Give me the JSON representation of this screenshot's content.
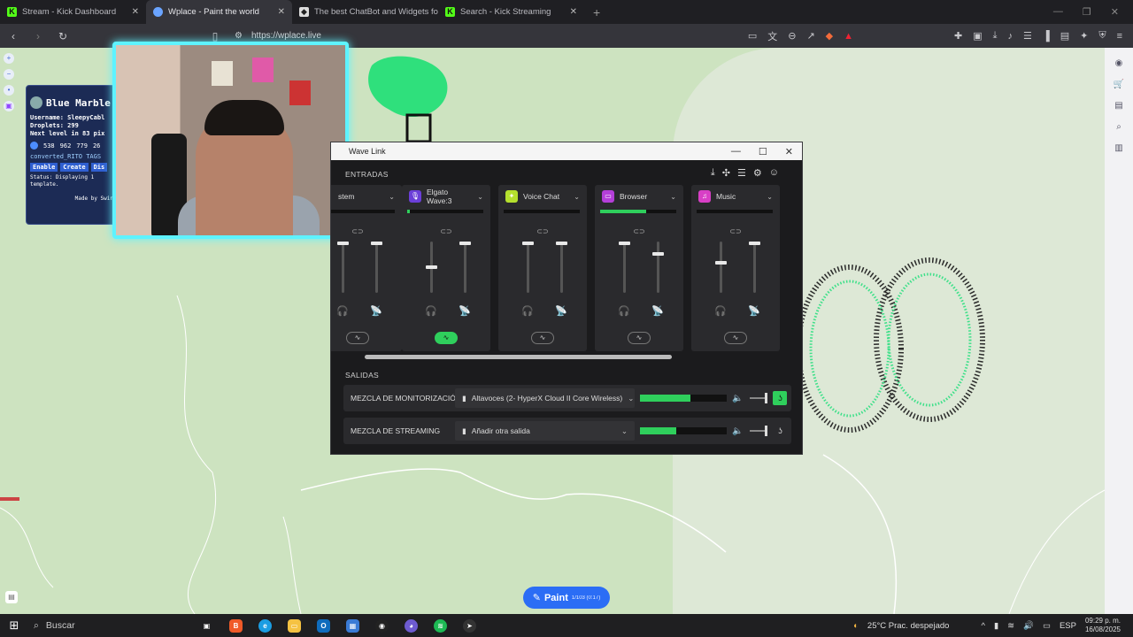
{
  "browser": {
    "tabs": [
      {
        "title": "Stream - Kick Dashboard",
        "icon": "K",
        "kind": "kick",
        "active": false
      },
      {
        "title": "Wplace - Paint the world",
        "icon": "",
        "kind": "wplace",
        "active": true
      },
      {
        "title": "The best ChatBot and Widgets fo",
        "icon": "◆",
        "kind": "chat",
        "active": false
      },
      {
        "title": "Search - Kick Streaming",
        "icon": "K",
        "kind": "kick",
        "active": false
      }
    ],
    "url": "https://wplace.live"
  },
  "overlay": {
    "title": "Blue Marble",
    "username": "Username: SleepyCabl",
    "droplets": "Droplets: 299",
    "next_level": "Next level in 83 pix",
    "coords": [
      "538",
      "962",
      "779",
      "26"
    ],
    "template": "converted_RITO TAGS",
    "btn_enable": "Enable",
    "btn_create": "Create",
    "btn_disable": "Dis",
    "status": "Status: Displaying 1 template.",
    "made_by": "Made by Swin"
  },
  "wavelink": {
    "window_title": "Wave Link",
    "inputs_label": "ENTRADAS",
    "outputs_label": "SALIDAS",
    "channels": [
      {
        "name": "stem",
        "icon_color": "#2a2a2d",
        "icon_glyph": "",
        "meter": 0.0,
        "fader1": 0.0,
        "fader2": 0.0,
        "fx_on": false
      },
      {
        "name": "Elgato Wave:3",
        "icon_color": "#6b3fd8",
        "icon_glyph": "🎙",
        "meter": 0.04,
        "fader1": 0.5,
        "fader2": 0.0,
        "fx_on": true
      },
      {
        "name": "Voice Chat",
        "icon_color": "#b5e02e",
        "icon_glyph": "✦",
        "meter": 0.0,
        "fader1": 0.0,
        "fader2": 0.0,
        "fx_on": false
      },
      {
        "name": "Browser",
        "icon_color": "#b43fd8",
        "icon_glyph": "▭",
        "meter": 0.6,
        "fader1": 0.0,
        "fader2": 0.22,
        "fx_on": false
      },
      {
        "name": "Music",
        "icon_color": "#d83fc6",
        "icon_glyph": "♫",
        "meter": 0.0,
        "fader1": 0.4,
        "fader2": 0.0,
        "fx_on": false
      }
    ],
    "outputs": [
      {
        "label": "MEZCLA DE MONITORIZACIÓN",
        "device": "Altavoces (2- HyperX Cloud II Core Wireless)",
        "meter": 0.58,
        "listen_on": true
      },
      {
        "label": "MEZCLA DE STREAMING",
        "device": "Añadir otra salida",
        "meter": 0.42,
        "listen_on": false
      }
    ]
  },
  "map": {
    "paint_label": "Paint",
    "paint_count": "1/103 (0:17)"
  },
  "taskbar": {
    "search_label": "Buscar",
    "weather": "25°C  Prac. despejado",
    "lang": "ESP",
    "time": "09:29 p. m.",
    "date": "16/08/2025"
  }
}
